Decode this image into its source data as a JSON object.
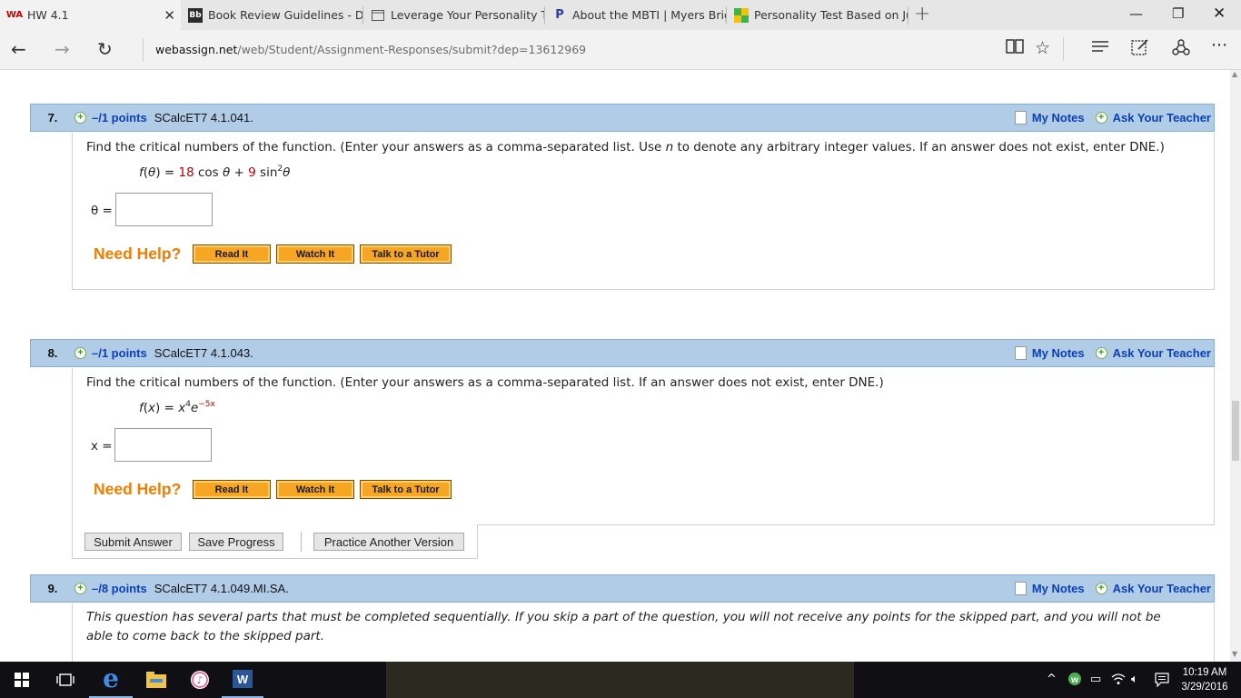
{
  "browser": {
    "tabs": [
      {
        "favicon": "WA",
        "title": "HW 4.1",
        "active": true
      },
      {
        "favicon": "Bb",
        "title": "Book Review Guidelines - D"
      },
      {
        "favicon": "page",
        "title": "Leverage Your Personality Ty"
      },
      {
        "favicon": "P",
        "title": "About the MBTI | Myers Brig"
      },
      {
        "favicon": "test",
        "title": "Personality Test Based on Ju"
      }
    ],
    "url_host": "webassign.net",
    "url_path": "/web/Student/Assignment-Responses/submit?dep=13612969"
  },
  "questions": [
    {
      "number": "7.",
      "points": "–/1 points",
      "code": "SCalcET7 4.1.041.",
      "my_notes": "My Notes",
      "ask_teacher": "Ask Your Teacher",
      "prompt_a": "Find the critical numbers of the function. (Enter your answers as a comma-separated list. Use ",
      "prompt_var": "n",
      "prompt_b": " to denote any arbitrary integer values. If an answer does not exist, enter DNE.)",
      "formula": {
        "lhs": "f(θ) = ",
        "c1": "18",
        "t1": " cos θ + ",
        "c2": "9",
        "t2": " sin",
        "exp": "2",
        "t3": "θ"
      },
      "answer_label": "θ =",
      "answer_value": "",
      "need_help": "Need Help?",
      "help_buttons": [
        "Read It",
        "Watch It",
        "Talk to a Tutor"
      ]
    },
    {
      "number": "8.",
      "points": "–/1 points",
      "code": "SCalcET7 4.1.043.",
      "my_notes": "My Notes",
      "ask_teacher": "Ask Your Teacher",
      "prompt": "Find the critical numbers of the function. (Enter your answers as a comma-separated list. If an answer does not exist, enter DNE.)",
      "formula": {
        "lhs": "f(x) = x",
        "exp1": "4",
        "mid": "e",
        "exp2": "−5x"
      },
      "answer_label": "x =",
      "answer_value": "",
      "need_help": "Need Help?",
      "help_buttons": [
        "Read It",
        "Watch It",
        "Talk to a Tutor"
      ]
    },
    {
      "number": "9.",
      "points": "–/8 points",
      "code": "SCalcET7 4.1.049.MI.SA.",
      "my_notes": "My Notes",
      "ask_teacher": "Ask Your Teacher",
      "prompt": "This question has several parts that must be completed sequentially. If you skip a part of the question, you will not receive any points for the skipped part, and you will not be able to come back to the skipped part."
    }
  ],
  "actions": {
    "submit": "Submit Answer",
    "save": "Save Progress",
    "practice": "Practice Another Version"
  },
  "taskbar": {
    "time": "10:19 AM",
    "date": "3/29/2016"
  }
}
